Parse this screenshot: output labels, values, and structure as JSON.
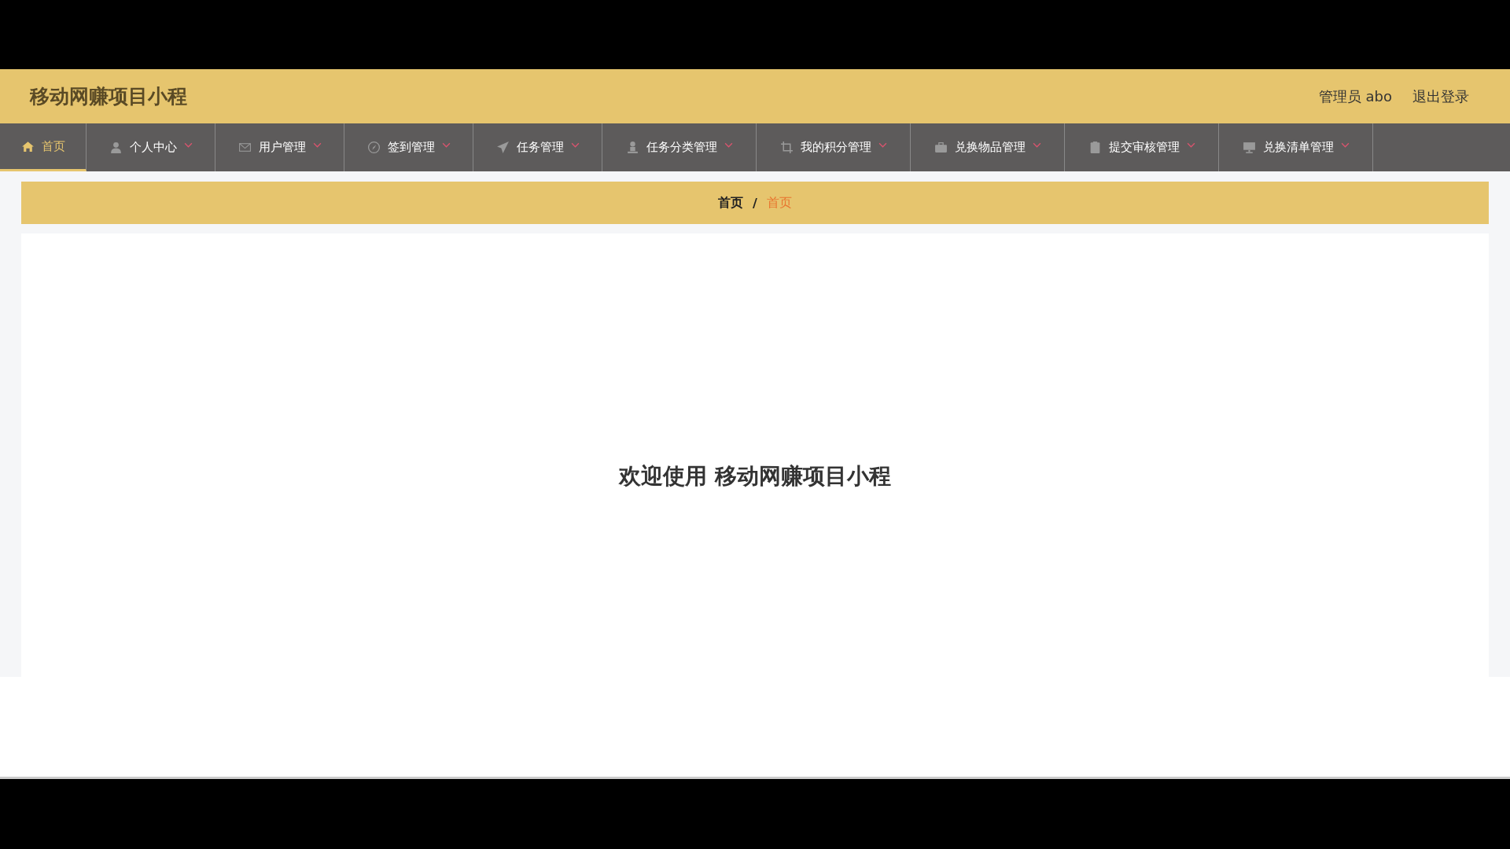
{
  "header": {
    "title": "移动网赚项目小程",
    "user": "管理员 abo",
    "logout": "退出登录"
  },
  "nav": [
    {
      "label": "首页",
      "selected": true,
      "dropdown": false
    },
    {
      "label": "个人中心",
      "selected": false,
      "dropdown": true
    },
    {
      "label": "用户管理",
      "selected": false,
      "dropdown": true
    },
    {
      "label": "签到管理",
      "selected": false,
      "dropdown": true
    },
    {
      "label": "任务管理",
      "selected": false,
      "dropdown": true
    },
    {
      "label": "任务分类管理",
      "selected": false,
      "dropdown": true
    },
    {
      "label": "我的积分管理",
      "selected": false,
      "dropdown": true
    },
    {
      "label": "兑换物品管理",
      "selected": false,
      "dropdown": true
    },
    {
      "label": "提交审核管理",
      "selected": false,
      "dropdown": true
    },
    {
      "label": "兑换清单管理",
      "selected": false,
      "dropdown": true
    }
  ],
  "breadcrumb": {
    "items": [
      "首页",
      "首页"
    ],
    "separator": "/"
  },
  "welcome": "欢迎使用 移动网赚项目小程"
}
